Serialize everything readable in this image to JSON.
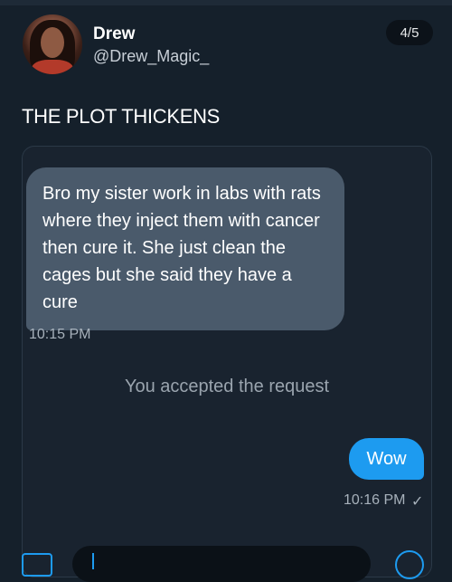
{
  "profile": {
    "name": "Drew",
    "handle": "@Drew_Magic_",
    "avatar_icon": "profile-photo"
  },
  "image_counter": "4/5",
  "tweet": {
    "text": "THE PLOT THICKENS"
  },
  "conversation": {
    "incoming_message": "Bro my sister work in labs with rats where they inject them with cancer then cure it. She just clean the cages but she said they have a cure",
    "incoming_time": "10:15 PM",
    "system_message": "You accepted the request",
    "outgoing_message": "Wow",
    "outgoing_time": "10:16 PM",
    "read_receipt": "✓"
  },
  "composer": {
    "media_icon": "image-icon",
    "send_icon": "send-icon"
  },
  "colors": {
    "background": "#15202b",
    "incoming_bubble": "#4a5a6b",
    "outgoing_bubble": "#1d9bf0"
  }
}
